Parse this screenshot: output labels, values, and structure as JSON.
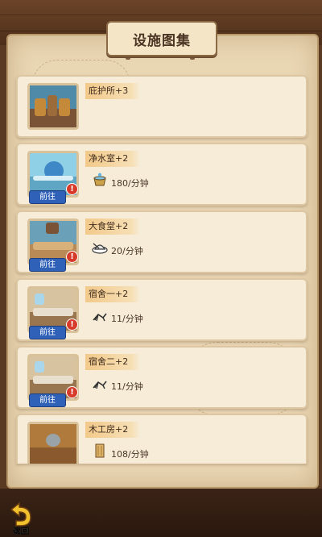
{
  "title": "设施图集",
  "back_label": "返回",
  "go_label": "前往",
  "alert_glyph": "!",
  "facilities": [
    {
      "name": "庇护所+3",
      "rate": "",
      "icon": "",
      "has_go": false
    },
    {
      "name": "净水室+2",
      "rate": "180/分钟",
      "icon": "water-bucket-icon",
      "has_go": true
    },
    {
      "name": "大食堂+2",
      "rate": "20/分钟",
      "icon": "food-plate-icon",
      "has_go": true
    },
    {
      "name": "宿舍一+2",
      "rate": "11/分钟",
      "icon": "lounge-chair-icon",
      "has_go": true
    },
    {
      "name": "宿舍二+2",
      "rate": "11/分钟",
      "icon": "lounge-chair-icon",
      "has_go": true
    },
    {
      "name": "木工房+2",
      "rate": "108/分钟",
      "icon": "wood-plank-icon",
      "has_go": true
    }
  ],
  "colors": {
    "go_button": "#2f61b8",
    "alert": "#d83a2a",
    "name_tag": "#f2c98a",
    "card_bg": "#f6ecd8"
  }
}
